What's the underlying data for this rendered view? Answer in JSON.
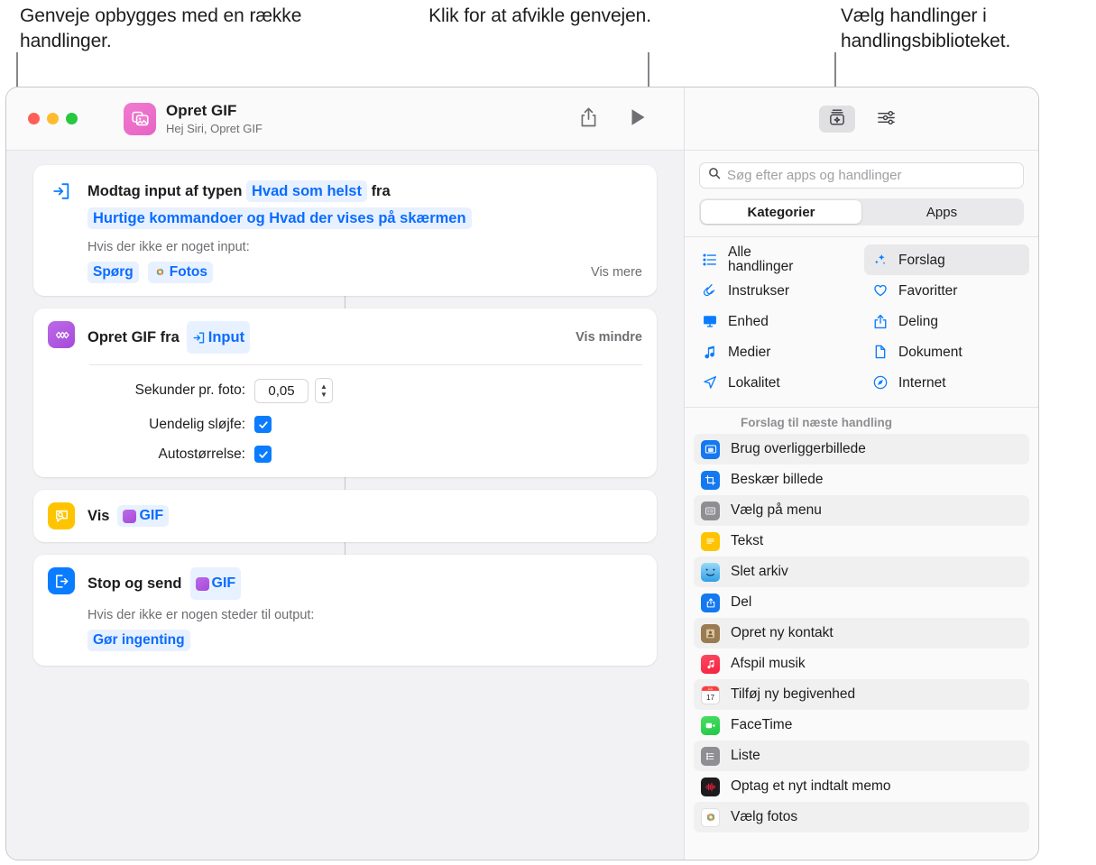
{
  "annotations": [
    {
      "id": "left",
      "text": "Genveje opbygges med en række handlinger."
    },
    {
      "id": "mid",
      "text": "Klik for at afvikle genvejen."
    },
    {
      "id": "right",
      "text": "Vælg handlinger i handlingsbiblioteket."
    }
  ],
  "window": {
    "titlebar": {
      "title": "Opret GIF",
      "subtitle": "Hej Siri, Opret GIF",
      "share_button": "share-icon",
      "run_button": "play-icon"
    }
  },
  "editor": {
    "actions": [
      {
        "id": "receive-input",
        "icon": "receive-input-icon",
        "text_before": "Modtag input af typen",
        "token_type": "Hvad som helst",
        "text_middle": "fra",
        "token_source": "Hurtige kommandoer og Hvad der vises på skærmen",
        "sub_label": "Hvis der ikke er noget input:",
        "token_ask": "Spørg",
        "token_app": "Fotos",
        "toggle": "Vis mere"
      },
      {
        "id": "create-gif",
        "icon": "create-gif-icon",
        "title": "Opret GIF fra",
        "token_input": "Input",
        "toggle": "Vis mindre",
        "fields": [
          {
            "label": "Sekunder pr. foto:",
            "type": "number",
            "value": "0,05"
          },
          {
            "label": "Uendelig sløjfe:",
            "type": "checkbox",
            "checked": true
          },
          {
            "label": "Autostørrelse:",
            "type": "checkbox",
            "checked": true
          }
        ]
      },
      {
        "id": "show-result",
        "icon": "quick-look-icon",
        "title": "Vis",
        "token_var": "GIF"
      },
      {
        "id": "stop-and-output",
        "icon": "stop-output-icon",
        "title": "Stop og send",
        "token_var": "GIF",
        "sub_label": "Hvis der ikke er nogen steder til output:",
        "token_action": "Gør ingenting"
      }
    ]
  },
  "library": {
    "toolbar": {
      "action_library_button": "action-library-icon",
      "details_button": "sliders-icon"
    },
    "search": {
      "placeholder": "Søg efter apps og handlinger",
      "icon": "search-icon"
    },
    "segmented": {
      "options": [
        "Kategorier",
        "Apps"
      ],
      "selected": "Kategorier"
    },
    "categories": [
      {
        "label": "Alle handlinger",
        "icon": "list-icon",
        "selected": false,
        "two_line": true
      },
      {
        "label": "Forslag",
        "icon": "sparkle-icon",
        "selected": true
      },
      {
        "label": "Instrukser",
        "icon": "scripting-icon",
        "selected": false
      },
      {
        "label": "Favoritter",
        "icon": "heart-icon",
        "selected": false
      },
      {
        "label": "Enhed",
        "icon": "display-icon",
        "selected": false
      },
      {
        "label": "Deling",
        "icon": "share-icon",
        "selected": false
      },
      {
        "label": "Medier",
        "icon": "music-note-icon",
        "selected": false
      },
      {
        "label": "Dokument",
        "icon": "document-icon",
        "selected": false
      },
      {
        "label": "Lokalitet",
        "icon": "location-icon",
        "selected": false
      },
      {
        "label": "Internet",
        "icon": "safari-icon",
        "selected": false
      }
    ],
    "suggestions_header": "Forslag til næste handling",
    "suggestions": [
      {
        "label": "Brug overliggerbillede",
        "icon": "overlay-image-icon",
        "color": "#1479f0"
      },
      {
        "label": "Beskær billede",
        "icon": "crop-image-icon",
        "color": "#1479f0"
      },
      {
        "label": "Vælg på menu",
        "icon": "menu-select-icon",
        "color": "#8e8e93"
      },
      {
        "label": "Tekst",
        "icon": "text-icon",
        "color": "#ffcc00"
      },
      {
        "label": "Slet arkiv",
        "icon": "finder-icon",
        "color": "#36a8f0"
      },
      {
        "label": "Del",
        "icon": "share-sheet-icon",
        "color": "#1479f0"
      },
      {
        "label": "Opret ny kontakt",
        "icon": "contacts-icon",
        "color": "#9a7b52"
      },
      {
        "label": "Afspil musik",
        "icon": "music-app-icon",
        "color": "#fa2d48"
      },
      {
        "label": "Tilføj ny begivenhed",
        "icon": "calendar-icon",
        "color": "#ffffff"
      },
      {
        "label": "FaceTime",
        "icon": "facetime-icon",
        "color": "#32d74b"
      },
      {
        "label": "Liste",
        "icon": "list-item-icon",
        "color": "#8e8e93"
      },
      {
        "label": "Optag et nyt indtalt memo",
        "icon": "voice-memos-icon",
        "color": "#1c1c1e"
      },
      {
        "label": "Vælg fotos",
        "icon": "photos-icon",
        "color": "#ffffff"
      }
    ]
  },
  "colors": {
    "accent_blue": "#0a7cff",
    "token_bg": "#e8f1ff",
    "purple": "#a855e0",
    "yellow": "#ffc400",
    "blue": "#0a7cff"
  }
}
